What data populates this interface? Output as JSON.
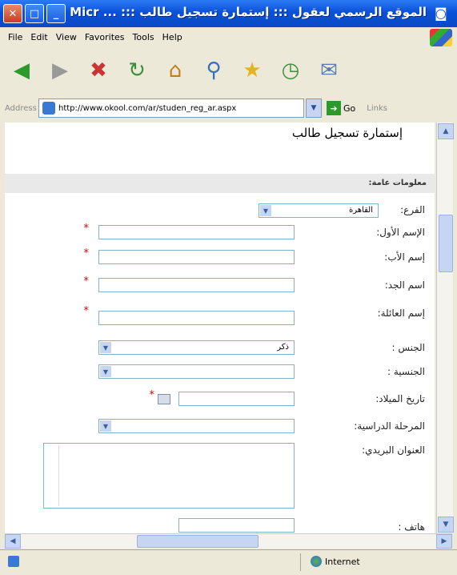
{
  "window": {
    "title": "الموقع الرسمي لعقول ::: إستمارة تسجيل طالب ::: ... Micr"
  },
  "menu": [
    "File",
    "Edit",
    "View",
    "Favorites",
    "Tools",
    "Help"
  ],
  "address": {
    "label": "Address",
    "url": "http://www.okool.com/ar/studen_reg_ar.aspx",
    "go": "Go",
    "links": "Links"
  },
  "page": {
    "heading": "إستمارة تسجيل طالب",
    "section_title": "معلومات عامة:"
  },
  "form": {
    "branch": {
      "label": "الفرع:",
      "value": "القاهرة"
    },
    "first_name": {
      "label": "الإسم الأول:"
    },
    "father_name": {
      "label": "إسم الأب:"
    },
    "grandfather_name": {
      "label": "اسم الجد:"
    },
    "family_name": {
      "label": "إسم العائلة:"
    },
    "gender": {
      "label": "الجنس :",
      "value": "ذكر"
    },
    "nationality": {
      "label": "الجنسية :"
    },
    "birth_date": {
      "label": "تاريخ الميلاد:"
    },
    "stage": {
      "label": "المرحلة الدراسية:"
    },
    "postal_address": {
      "label": "العنوان البريدي:"
    },
    "next_label": "هاتف :"
  },
  "status": {
    "zone": "Internet"
  },
  "icons": {
    "window": "ie-window-icon",
    "back": "back-icon",
    "forward": "forward-icon",
    "stop": "stop-icon",
    "refresh": "refresh-icon",
    "home": "home-icon",
    "search": "search-icon",
    "favorites": "favorites-icon",
    "history": "history-icon",
    "mail": "mail-icon"
  }
}
